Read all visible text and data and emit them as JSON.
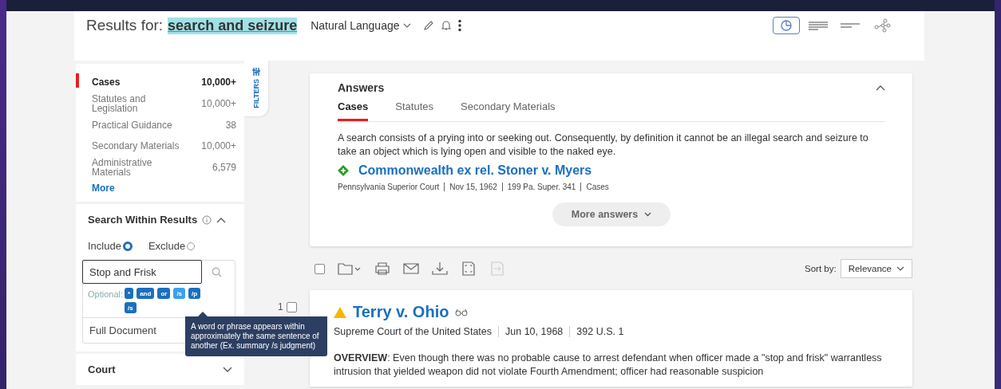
{
  "header": {
    "label": "Results for:",
    "query": "search and seizure",
    "search_type": "Natural Language"
  },
  "view_modes": [
    {
      "kind": "chart",
      "selected": true
    },
    {
      "kind": "detailed",
      "selected": false
    },
    {
      "kind": "compact",
      "selected": false
    },
    {
      "kind": "graph",
      "selected": false
    }
  ],
  "filters_tab": "FILTERS",
  "categories": [
    {
      "label": "Cases",
      "count": "10,000+",
      "selected": true
    },
    {
      "label": "Statutes and Legislation",
      "count": "10,000+",
      "selected": false
    },
    {
      "label": "Practical Guidance",
      "count": "38",
      "selected": false
    },
    {
      "label": "Secondary Materials",
      "count": "10,000+",
      "selected": false
    },
    {
      "label": "Administrative Materials",
      "count": "6,579",
      "selected": false
    }
  ],
  "more_link": "More",
  "search_within": {
    "title": "Search Within Results",
    "expanded": true,
    "modes": [
      {
        "label": "Include",
        "selected": true
      },
      {
        "label": "Exclude",
        "selected": false
      }
    ],
    "value": "Stop and Frisk",
    "optional_label": "Optional:",
    "connectors": [
      {
        "label": "*",
        "selected": false
      },
      {
        "label": "and",
        "selected": false
      },
      {
        "label": "or",
        "selected": false
      },
      {
        "label": "/s",
        "selected": true
      },
      {
        "label": "/p",
        "selected": false
      },
      {
        "label": "/s",
        "selected": false
      }
    ],
    "scope": "Full Document"
  },
  "tooltip": "A word or phrase appears within approximately the same sentence of another (Ex. summary /s judgment)",
  "court": {
    "title": "Court",
    "expanded": false
  },
  "answers": {
    "title": "Answers",
    "expanded": true,
    "tabs": [
      {
        "label": "Cases",
        "selected": true
      },
      {
        "label": "Statutes",
        "selected": false
      },
      {
        "label": "Secondary Materials",
        "selected": false
      }
    ],
    "text": "A search consists of a prying into or seeking out. Consequently, by definition it cannot be an illegal search and seizure to take an object which is lying open and visible to the naked eye.",
    "case_title": "Commonwealth ex rel. Stoner v. Myers",
    "case_meta": [
      "Pennsylvania Superior Court",
      "Nov 15, 1962",
      "199 Pa. Super. 341",
      "Cases"
    ],
    "more": "More answers"
  },
  "toolbar": {
    "select_all_checked": false,
    "actions": [
      {
        "kind": "folder",
        "disabled": false
      },
      {
        "kind": "print",
        "disabled": false
      },
      {
        "kind": "mail",
        "disabled": false
      },
      {
        "kind": "download",
        "disabled": false
      },
      {
        "kind": "expand",
        "disabled": false
      },
      {
        "kind": "export",
        "disabled": true
      }
    ],
    "sort_label": "Sort by:",
    "sort_value": "Relevance"
  },
  "results": [
    {
      "number": "1",
      "checked": false,
      "title": "Terry v. Ohio",
      "meta": [
        "Supreme Court of the United States",
        "Jun 10, 1968",
        "392 U.S. 1"
      ],
      "overview": "**OVERVIEW**: Even though there was no probable cause to arrest defendant when officer made a \"stop and frisk\" warrantless intrusion that yielded weapon did not violate Fourth Amendment; officer had reasonable suspicion"
    }
  ]
}
